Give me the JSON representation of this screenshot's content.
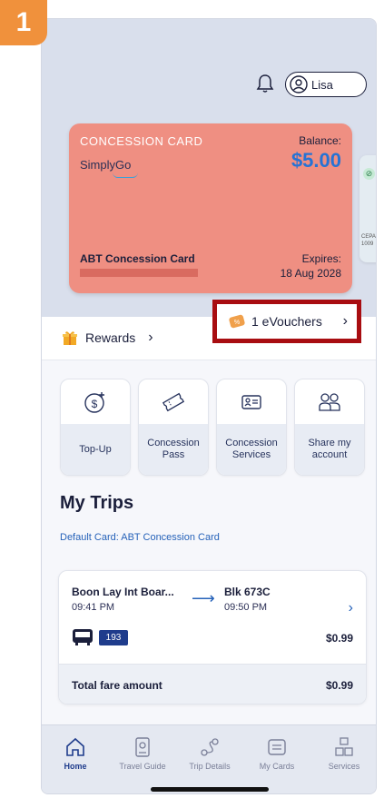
{
  "step_badge": "1",
  "header": {
    "user_name": "Lisa"
  },
  "card": {
    "type_label": "CONCESSION CARD",
    "brand": "SimplyGo",
    "balance_label": "Balance:",
    "balance_value": "$5.00",
    "card_name": "ABT Concession Card",
    "expires_label": "Expires:",
    "expires_value": "18 Aug 2028",
    "peek_text_1": "CEPA",
    "peek_text_2": "1009"
  },
  "rewards": {
    "rewards_label": "Rewards",
    "vouchers_label": "1 eVouchers",
    "highlight_color": "#a80d11"
  },
  "services": [
    {
      "label": "Top-Up",
      "icon": "dollar-plus-icon"
    },
    {
      "label": "Concession Pass",
      "icon": "ticket-icon"
    },
    {
      "label": "Concession Services",
      "icon": "id-card-icon"
    },
    {
      "label": "Share my account",
      "icon": "users-icon"
    }
  ],
  "trips": {
    "title": "My Trips",
    "default_card": "Default Card:  ABT Concession Card",
    "items": [
      {
        "from": "Boon Lay Int Boar...",
        "from_time": "09:41 PM",
        "to": "Blk 673C",
        "to_time": "09:50 PM",
        "bus_number": "193",
        "fare": "$0.99"
      }
    ],
    "total_label": "Total fare amount",
    "total_value": "$0.99"
  },
  "tabbar": [
    {
      "label": "Home",
      "icon": "home-icon",
      "active": true
    },
    {
      "label": "Travel Guide",
      "icon": "travel-guide-icon",
      "active": false
    },
    {
      "label": "Trip Details",
      "icon": "route-icon",
      "active": false
    },
    {
      "label": "My Cards",
      "icon": "cards-icon",
      "active": false
    },
    {
      "label": "Services",
      "icon": "services-icon",
      "active": false
    }
  ],
  "colors": {
    "card_bg": "#ef8f82",
    "balance": "#2673d4",
    "primary": "#1f3c8c",
    "step_badge": "#f0913c"
  }
}
